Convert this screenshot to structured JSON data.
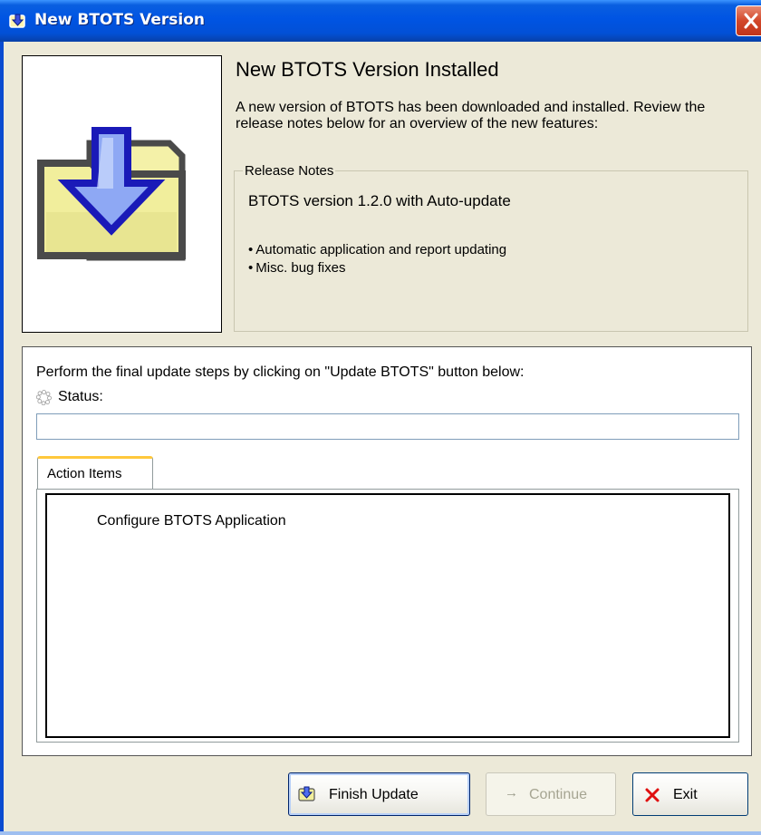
{
  "window": {
    "title": "New BTOTS Version"
  },
  "header": {
    "heading": "New BTOTS Version Installed",
    "intro": "A new version of BTOTS has been downloaded and installed. Review the release notes below for an overview of the new features:"
  },
  "release_notes": {
    "legend": "Release Notes",
    "version_line": "BTOTS version 1.2.0 with Auto-update",
    "items": [
      "Automatic application and report updating",
      "Misc. bug fixes"
    ]
  },
  "update": {
    "instruction": "Perform the final update steps by clicking on \"Update BTOTS\" button below:",
    "status_label": "Status:",
    "status_value": ""
  },
  "tabs": {
    "active_label": "Action Items",
    "items": [
      "Configure BTOTS Application"
    ]
  },
  "buttons": {
    "finish_label": "Finish Update",
    "continue_label": "Continue",
    "exit_label": "Exit"
  },
  "icons": {
    "title": "update-app-icon",
    "close": "close-icon",
    "download": "download-arrow-icon",
    "status": "spinner-icon",
    "finish": "update-app-icon",
    "continue": "arrow-right-icon",
    "exit": "x-icon"
  },
  "colors": {
    "titlebar": "#0054e3",
    "close": "#d2472a",
    "arrow": "#4f6ef0",
    "folder": "#f1ee9c",
    "exit_x": "#e01010"
  }
}
